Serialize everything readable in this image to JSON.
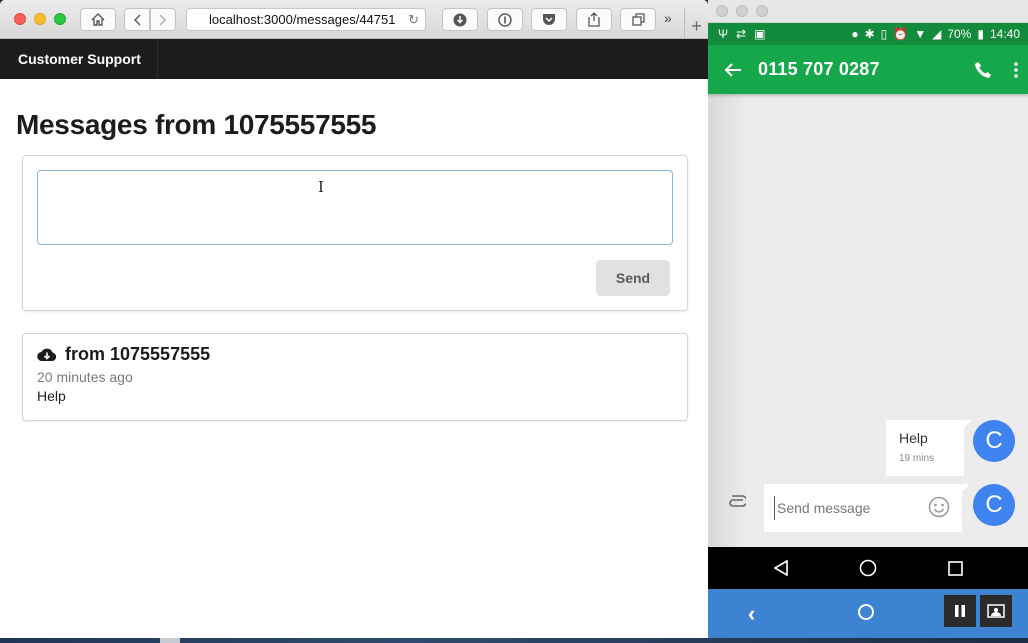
{
  "browser": {
    "url": "localhost:3000/messages/44751",
    "brand": "Customer Support"
  },
  "page": {
    "title": "Messages from 1075557555",
    "compose": {
      "value": "",
      "send_label": "Send"
    },
    "messages": [
      {
        "header": "from 1075557555",
        "time": "20 minutes ago",
        "body": "Help"
      }
    ]
  },
  "phone": {
    "status": {
      "battery": "70%",
      "time": "14:40"
    },
    "contact": "0115 707 0287",
    "conversation": [
      {
        "text": "Help",
        "time": "19 mins",
        "avatar_letter": "C"
      }
    ],
    "composer": {
      "placeholder": "Send message",
      "avatar_letter": "C"
    }
  },
  "colors": {
    "phone_status_bar": "#128c3c",
    "phone_app_bar": "#15a74a",
    "avatar": "#3f83f0",
    "host_nav": "#3d83d1",
    "browser_navbar": "#1b1c1d"
  }
}
